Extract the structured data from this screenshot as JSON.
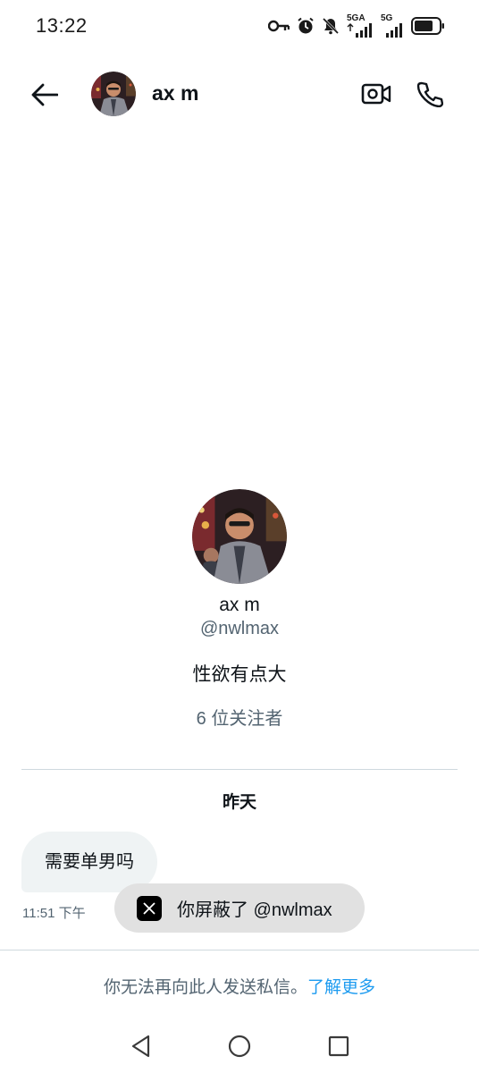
{
  "status_bar": {
    "time": "13:22",
    "network_1": "5GA",
    "network_2": "5G",
    "icons": [
      "vpn-key-icon",
      "alarm-icon",
      "mute-icon",
      "signal-icon",
      "signal-icon",
      "battery-icon"
    ]
  },
  "header": {
    "name": "ax m",
    "back_icon": "arrow-left-icon",
    "video_icon": "video-call-icon",
    "call_icon": "phone-icon"
  },
  "profile": {
    "name": "ax m",
    "handle": "@nwlmax",
    "bio": "性欲有点大",
    "followers": "6 位关注者"
  },
  "conversation": {
    "date_label": "昨天",
    "messages": [
      {
        "text": "需要单男吗",
        "time": "11:51 下午"
      }
    ]
  },
  "toast": {
    "logo": "x-logo-icon",
    "text": "你屏蔽了 @nwlmax"
  },
  "footer": {
    "note": "你无法再向此人发送私信。",
    "learn_more": "了解更多"
  },
  "nav_bar": {
    "icons": [
      "nav-back-icon",
      "nav-home-icon",
      "nav-recents-icon"
    ]
  },
  "colors": {
    "accent": "#1d9bf0",
    "secondary_text": "#536471",
    "bubble": "#eff3f4",
    "toast": "#e1e1e1"
  }
}
